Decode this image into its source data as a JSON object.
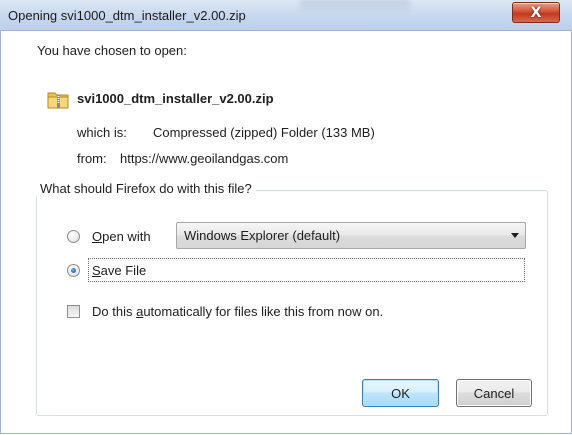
{
  "window": {
    "title": "Opening svi1000_dtm_installer_v2.00.zip",
    "close_symbol": "X"
  },
  "dialog": {
    "heading": "You have chosen to open:",
    "file_name": "svi1000_dtm_installer_v2.00.zip",
    "file_icon": "zip-archive-icon",
    "which_is_label": "which is:",
    "which_is_value": "Compressed (zipped) Folder (133 MB)",
    "from_label": "from:",
    "from_value": "https://www.geoilandgas.com"
  },
  "action_group": {
    "legend": "What should Firefox do with this file?",
    "open_with": {
      "mnemonic": "O",
      "rest": "pen with",
      "selected": false
    },
    "open_with_app": {
      "value": "Windows Explorer (default)"
    },
    "save_file": {
      "mnemonic": "S",
      "rest": "ave File",
      "selected": true
    },
    "auto_checkbox": {
      "prefix": "Do this ",
      "mnemonic": "a",
      "rest": "utomatically for files like this from now on.",
      "checked": false
    }
  },
  "buttons": {
    "ok": "OK",
    "cancel": "Cancel"
  },
  "colors": {
    "title_bar": "#c6d7ee",
    "close_button": "#c2391c",
    "default_button_border": "#3c7fb1"
  }
}
